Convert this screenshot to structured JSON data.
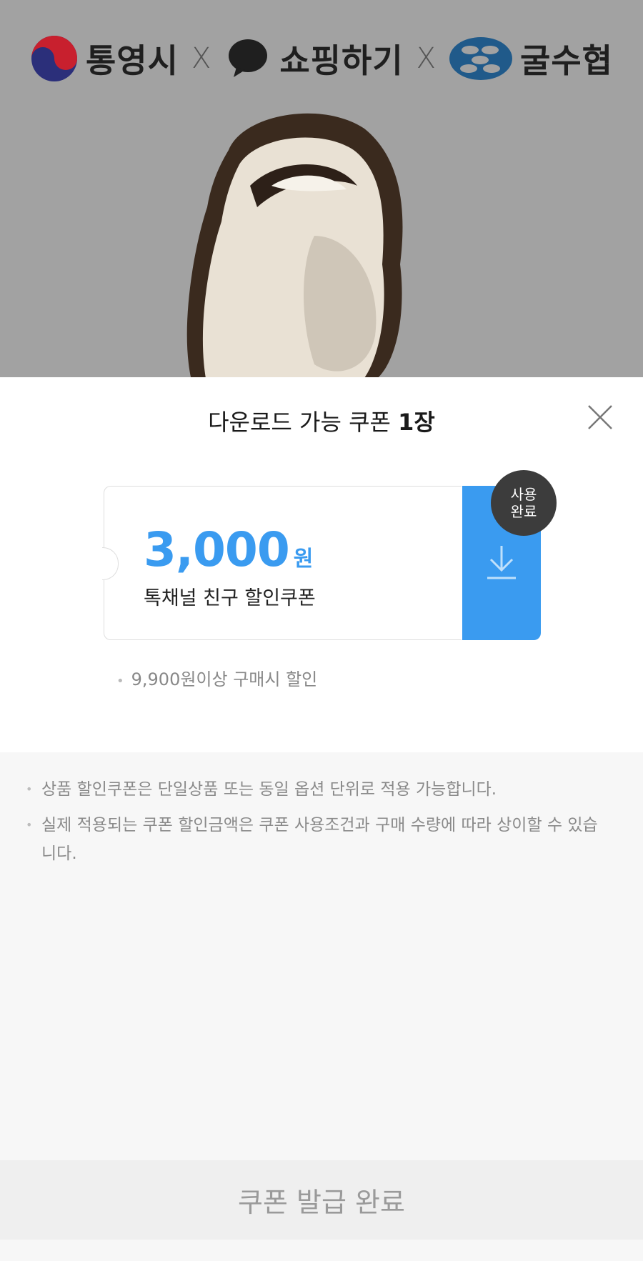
{
  "header": {
    "brands": [
      {
        "name": "통영시",
        "icon": "taegeuk-logo-icon"
      },
      {
        "name": "쇼핑하기",
        "icon": "speech-bubble-icon"
      },
      {
        "name": "굴수협",
        "icon": "fish-logo-icon"
      }
    ],
    "separator": "X"
  },
  "modal": {
    "title_prefix": "다운로드 가능 쿠폰",
    "title_count": "1장",
    "coupon": {
      "amount": "3,000",
      "unit": "원",
      "name": "톡채널 친구 할인쿠폰",
      "badge_line1": "사용",
      "badge_line2": "완료",
      "condition": "9,900원이상 구매시 할인"
    },
    "notices": [
      "상품 할인쿠폰은 단일상품 또는 동일 옵션 단위로 적용 가능합니다.",
      "실제 적용되는 쿠폰 할인금액은 쿠폰 사용조건과 구매 수량에 따라 상이할 수 있습니다."
    ],
    "bottom_button": "쿠폰 발급 완료"
  },
  "colors": {
    "accent": "#3a9bf0",
    "badge": "#3c3c3c",
    "rail": "#d40c0c"
  }
}
